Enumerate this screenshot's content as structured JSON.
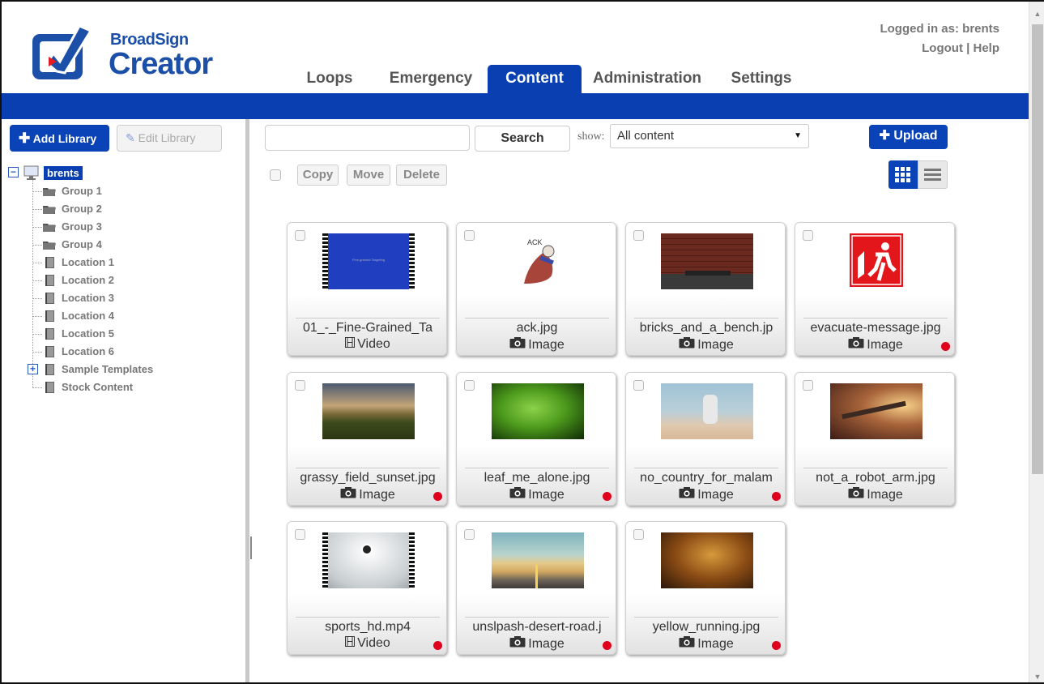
{
  "app": {
    "brand_small": "BroadSign",
    "brand_big": "Creator"
  },
  "header": {
    "tabs": [
      {
        "label": "Loops",
        "active": false
      },
      {
        "label": "Emergency",
        "active": false
      },
      {
        "label": "Content",
        "active": true
      },
      {
        "label": "Administration",
        "active": false
      },
      {
        "label": "Settings",
        "active": false
      }
    ],
    "logged_in": "Logged in as: brents",
    "logout": "Logout",
    "separator": "|",
    "help": "Help"
  },
  "sidebar": {
    "add_library": "Add Library",
    "edit_library": "Edit Library",
    "tree": {
      "root": "brents",
      "items": [
        {
          "label": "Group 1",
          "icon": "folder-icon"
        },
        {
          "label": "Group 2",
          "icon": "folder-icon"
        },
        {
          "label": "Group 3",
          "icon": "folder-icon"
        },
        {
          "label": "Group 4",
          "icon": "folder-icon"
        },
        {
          "label": "Location 1",
          "icon": "book-icon"
        },
        {
          "label": "Location 2",
          "icon": "book-icon"
        },
        {
          "label": "Location 3",
          "icon": "book-icon"
        },
        {
          "label": "Location 4",
          "icon": "book-icon"
        },
        {
          "label": "Location 5",
          "icon": "book-icon"
        },
        {
          "label": "Location 6",
          "icon": "book-icon"
        },
        {
          "label": "Sample Templates",
          "icon": "book-icon"
        },
        {
          "label": "Stock Content",
          "icon": "book-icon"
        }
      ]
    }
  },
  "toolbar": {
    "search_value": "",
    "search_button": "Search",
    "show_label": "show:",
    "show_value": "All content",
    "upload": "Upload",
    "copy": "Copy",
    "move": "Move",
    "delete": "Delete"
  },
  "content": {
    "items": [
      {
        "name": "01_-_Fine-Grained_Ta",
        "type": "Video",
        "type_icon": "film-icon",
        "flag": false,
        "thumb_caption": "Fine-grained Targeting"
      },
      {
        "name": "ack.jpg",
        "type": "Image",
        "type_icon": "camera-icon",
        "flag": false
      },
      {
        "name": "bricks_and_a_bench.jp",
        "type": "Image",
        "type_icon": "camera-icon",
        "flag": false
      },
      {
        "name": "evacuate-message.jpg",
        "type": "Image",
        "type_icon": "camera-icon",
        "flag": true
      },
      {
        "name": "grassy_field_sunset.jpg",
        "type": "Image",
        "type_icon": "camera-icon",
        "flag": true
      },
      {
        "name": "leaf_me_alone.jpg",
        "type": "Image",
        "type_icon": "camera-icon",
        "flag": true
      },
      {
        "name": "no_country_for_malam",
        "type": "Image",
        "type_icon": "camera-icon",
        "flag": true
      },
      {
        "name": "not_a_robot_arm.jpg",
        "type": "Image",
        "type_icon": "camera-icon",
        "flag": false
      },
      {
        "name": "sports_hd.mp4",
        "type": "Video",
        "type_icon": "film-icon",
        "flag": true
      },
      {
        "name": "unslpash-desert-road.j",
        "type": "Image",
        "type_icon": "camera-icon",
        "flag": true
      },
      {
        "name": "yellow_running.jpg",
        "type": "Image",
        "type_icon": "camera-icon",
        "flag": true
      }
    ]
  },
  "colors": {
    "brand_blue": "#0a3fb2",
    "flag_red": "#e0001b"
  }
}
